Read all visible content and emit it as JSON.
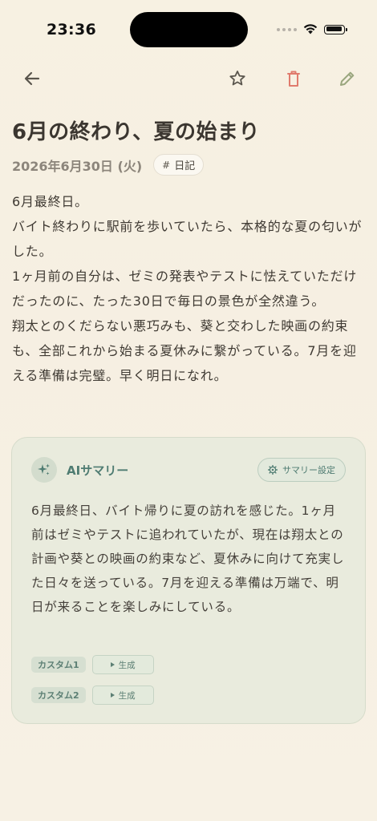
{
  "status": {
    "time": "23:36"
  },
  "toolbar": {
    "back_icon": "arrow-left-icon",
    "favorite_icon": "star-icon",
    "delete_icon": "trash-icon",
    "edit_icon": "pencil-icon"
  },
  "entry": {
    "title": "6月の終わり、夏の始まり",
    "date": "2026年6月30日 (火)",
    "tag": "日記",
    "tag_prefix": "#",
    "body": "6月最終日。\nバイト終わりに駅前を歩いていたら、本格的な夏の匂いがした。\n1ヶ月前の自分は、ゼミの発表やテストに怯えていただけだったのに、たった30日で毎日の景色が全然違う。\n翔太とのくだらない悪巧みも、葵と交わした映画の約束も、全部これから始まる夏休みに繋がっている。7月を迎える準備は完璧。早く明日になれ。"
  },
  "summary": {
    "title": "AIサマリー",
    "settings_label": "サマリー設定",
    "text": "6月最終日、バイト帰りに夏の訪れを感じた。1ヶ月前はゼミやテストに追われていたが、現在は翔太との計画や葵との映画の約束など、夏休みに向けて充実した日々を送っている。7月を迎える準備は万端で、明日が来ることを楽しみにしている。",
    "customs": [
      {
        "label": "カスタム1",
        "button": "生成"
      },
      {
        "label": "カスタム2",
        "button": "生成"
      }
    ]
  },
  "colors": {
    "background": "#f7f1e2",
    "accent_green": "#4f7c72",
    "delete_red": "#e07b6d",
    "edit_green": "#9aa67e",
    "card_bg": "#e9ebdd"
  }
}
